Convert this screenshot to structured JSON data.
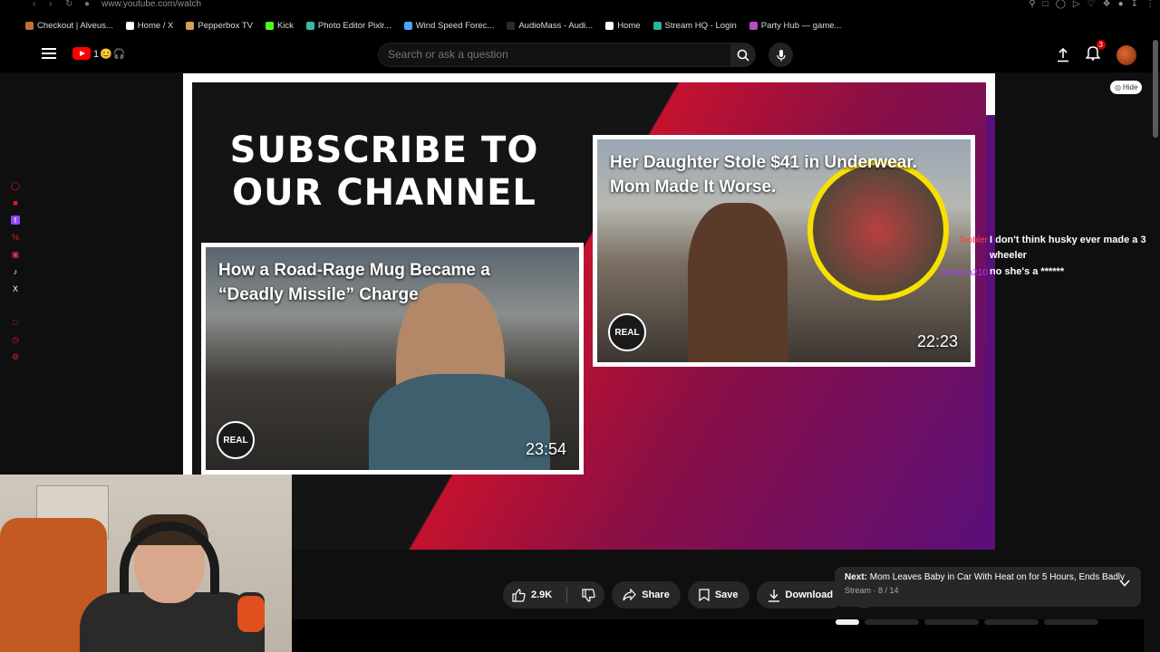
{
  "browser": {
    "url": "www.youtube.com/watch",
    "bookmarks": [
      {
        "label": "Checkout | Alveus...",
        "color": "#c0703a"
      },
      {
        "label": "Home / X",
        "color": "#ffffff"
      },
      {
        "label": "Pepperbox TV",
        "color": "#d4a05a"
      },
      {
        "label": "Kick",
        "color": "#53fc18"
      },
      {
        "label": "Photo Editor Pixlr...",
        "color": "#3bb8a6"
      },
      {
        "label": "Wind Speed Forec...",
        "color": "#4aa3ff"
      },
      {
        "label": "AudioMass - Audi...",
        "color": "#2a2a2a"
      },
      {
        "label": "Home",
        "color": "#ffffff"
      },
      {
        "label": "Stream HQ - Login",
        "color": "#2ab3a0"
      },
      {
        "label": "Party Hub — game...",
        "color": "#b84cc7"
      }
    ]
  },
  "header": {
    "search_placeholder": "Search or ask a question",
    "notification_count": "3",
    "logo_deco": "1😊🎧"
  },
  "video": {
    "headline": "SUBSCRIBE TO OUR CHANNEL",
    "cards": [
      {
        "title": "How a Road-Rage Mug Became a “Deadly Missile” Charge",
        "duration": "23:54",
        "brand": "REAL"
      },
      {
        "title": "Her Daughter Stole $41 in Underwear. Mom Made It Worse.",
        "duration": "22:23",
        "brand": "REAL"
      }
    ],
    "hide_label": "Hide"
  },
  "chat": {
    "messages": [
      {
        "user": "Toobler",
        "user_color": "#ff4040",
        "text": "I don't think husky ever made a 3 wheeler"
      },
      {
        "user": "Jacobsa210",
        "user_color": "#a040ff",
        "text": "no she's a ******"
      }
    ]
  },
  "actions": {
    "like_count": "2.9K",
    "share": "Share",
    "save": "Save",
    "download": "Download"
  },
  "next": {
    "prefix": "Next:",
    "title": "Mom Leaves Baby in Car With Heat on for 5 Hours, Ends Badly",
    "sub": "Stream · 8 / 14"
  },
  "colors": {
    "accent_red": "#ff0000",
    "highlight_yellow": "#f7e000"
  }
}
